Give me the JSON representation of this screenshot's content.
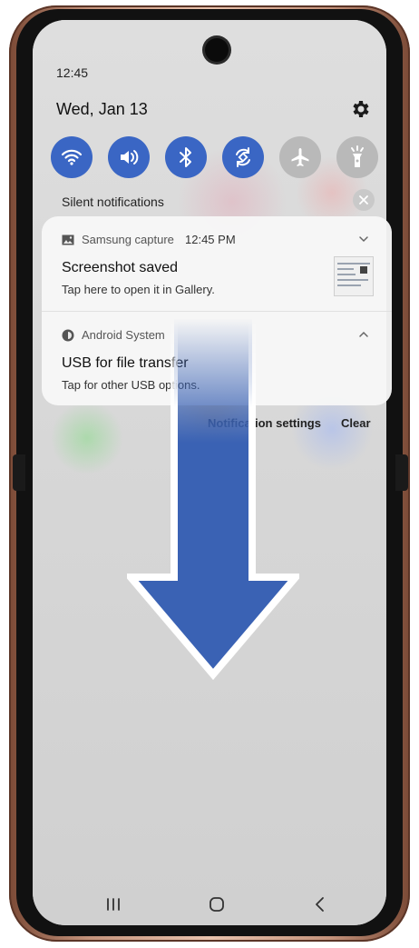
{
  "status": {
    "time": "12:45"
  },
  "panel": {
    "date": "Wed, Jan 13",
    "settings_icon": "gear-icon"
  },
  "quick_settings": [
    {
      "name": "wifi",
      "icon": "wifi-icon",
      "state": "on"
    },
    {
      "name": "sound",
      "icon": "speaker-icon",
      "state": "on"
    },
    {
      "name": "bluetooth",
      "icon": "bluetooth-icon",
      "state": "on"
    },
    {
      "name": "auto-rotate",
      "icon": "rotate-icon",
      "state": "on"
    },
    {
      "name": "airplane-mode",
      "icon": "airplane-icon",
      "state": "off"
    },
    {
      "name": "flashlight",
      "icon": "flashlight-icon",
      "state": "off"
    }
  ],
  "silent": {
    "label": "Silent notifications"
  },
  "notifications": [
    {
      "app": "Samsung capture",
      "time": "12:45 PM",
      "title": "Screenshot saved",
      "body": "Tap here to open it in Gallery.",
      "icon": "image-icon",
      "chevron": "chevron-down-icon"
    },
    {
      "app": "Android System",
      "title": "USB for file transfer",
      "body": "Tap for other USB options.",
      "icon": "android-system-icon",
      "chevron": "chevron-up-icon"
    }
  ],
  "actions": {
    "settings_label": "Notification settings",
    "clear_label": "Clear"
  },
  "nav": [
    {
      "name": "recents",
      "icon": "recents-icon"
    },
    {
      "name": "home",
      "icon": "home-icon"
    },
    {
      "name": "back",
      "icon": "back-icon"
    }
  ],
  "colors": {
    "toggle_on": "#3a66c4",
    "toggle_off": "#b9b9b9",
    "arrow_fill": "#3a62b4",
    "frame": "#c4937c"
  }
}
